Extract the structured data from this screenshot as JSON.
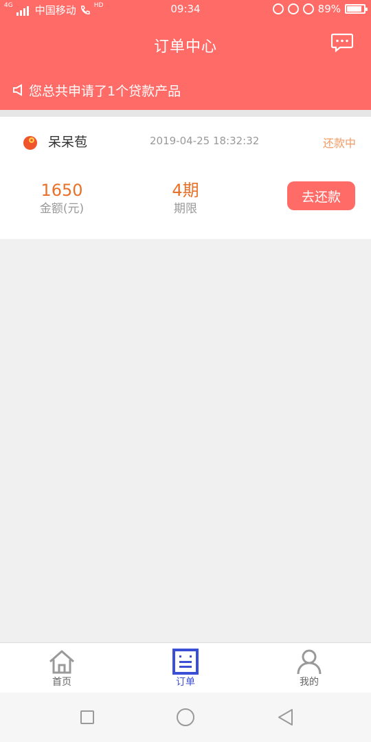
{
  "status_bar": {
    "network": "4G",
    "carrier": "中国移动",
    "hd": "HD",
    "time": "09:34",
    "battery": "89%",
    "battery_level": 0.89
  },
  "header": {
    "title": "订单中心",
    "message_icon": "chat-bubble-icon"
  },
  "notice": {
    "text": "您总共申请了1个贷款产品",
    "icon": "speaker-icon"
  },
  "order": {
    "product_name": "呆呆苞",
    "time": "2019-04-25 18:32:32",
    "status": "还款中",
    "amount_value": "1650",
    "amount_label": "金额(元)",
    "term_value": "4期",
    "term_label": "期限",
    "repay_button": "去还款"
  },
  "tabs": [
    {
      "label": "首页",
      "icon": "home-icon",
      "active": false
    },
    {
      "label": "订单",
      "icon": "order-icon",
      "active": true
    },
    {
      "label": "我的",
      "icon": "user-icon",
      "active": false
    }
  ],
  "colors": {
    "brand": "#ff6b67",
    "accent_orange": "#e8712a",
    "status_orange": "#f49a63",
    "tab_active": "#3b4fd6"
  }
}
